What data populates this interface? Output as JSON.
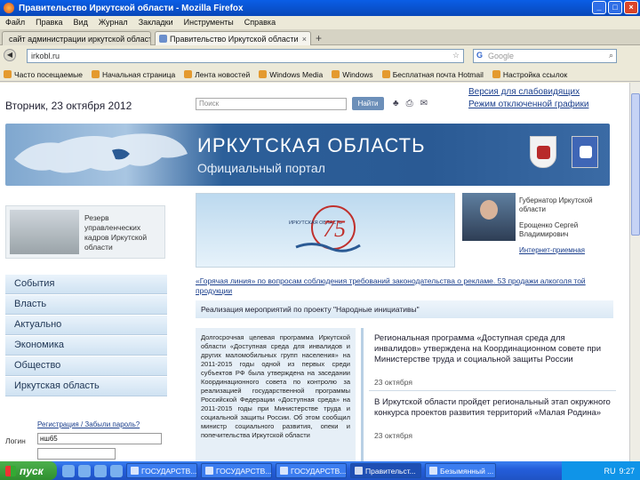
{
  "window": {
    "title": "Правительство Иркутской области - Mozilla Firefox"
  },
  "menubar": [
    "Файл",
    "Правка",
    "Вид",
    "Журнал",
    "Закладки",
    "Инструменты",
    "Справка"
  ],
  "tabs": [
    {
      "label": "сайт администрации иркутской области ...",
      "active": false
    },
    {
      "label": "Правительство Иркутской области",
      "active": true
    }
  ],
  "navbar": {
    "url": "irkobl.ru",
    "search_placeholder": "Google"
  },
  "bookmarks": [
    "Часто посещаемые",
    "Начальная страница",
    "Лента новостей",
    "Windows Media",
    "Windows",
    "Бесплатная почта Hotmail",
    "Настройка ссылок"
  ],
  "page": {
    "date": "Вторник, 23 октября 2012",
    "search": {
      "placeholder": "Поиск",
      "button": "Найти"
    },
    "access_links": [
      "Версия для слабовидящих",
      "Режим отключенной графики"
    ],
    "banner": {
      "title": "ИРКУТСКАЯ ОБЛАСТЬ",
      "subtitle": "Официальный портал"
    },
    "reserve_text": "Резерв управленческих кадров Иркутской области",
    "anniversary": {
      "label": "ИРКУТСКАЯ ОБЛАСТЬ",
      "number": "75"
    },
    "governor": {
      "role": "Губернатор Иркутской области",
      "name": "Ерощенко Сергей Владимирович",
      "link": "Интернет-приемная"
    },
    "left_nav": [
      "События",
      "Власть",
      "Актуально",
      "Экономика",
      "Общество",
      "Иркутская область"
    ],
    "hot_line": "«Горячая линия» по вопросам соблюдения требований законодательства о рекламе. 53 продажи алкоголя той продукции",
    "hot_bar": "Реализация мероприятий по проекту \"Народные инициативы\"",
    "news_left": "Долгосрочная целевая программа Иркутской области «Доступная среда для инвалидов и других маломобильных групп населения» на 2011-2015 годы одной из первых среди субъектов РФ была утверждена на заседании Координационного совета по контролю за реализацией государственной программы Российской Федерации «Доступная среда» на 2011-2015 годы при Министерстве труда и социальной защиты России. Об этом сообщил министр социального развития, опеки и попечительства Иркутской области",
    "news": [
      {
        "text": "Региональная программа «Доступная среда для инвалидов» утверждена на Координационном совете при Министерстве труда и социальной защиты России",
        "date": "23 октября"
      },
      {
        "text": "В Иркутской области пройдет региональный этап окружного конкурса проектов развития территорий «Малая Родина»",
        "date": "23 октября"
      }
    ],
    "login": {
      "link": "Регистрация / Забыли пароль?",
      "label": "Логин",
      "value": "нш65"
    }
  },
  "taskbar": {
    "start": "пуск",
    "tasks": [
      "ГОСУДАРСТВ...",
      "ГОСУДАРСТВ...",
      "ГОСУДАРСТВ...",
      "Правительст...",
      "Безымянный ..."
    ],
    "lang": "RU",
    "time": "9:27"
  }
}
